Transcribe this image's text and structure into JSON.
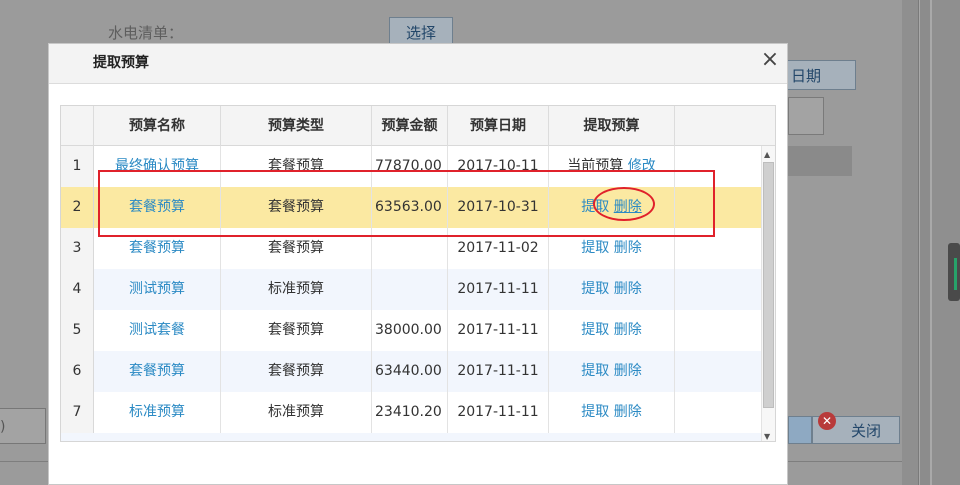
{
  "background": {
    "utility_label": "水电清单：",
    "select_button": "选择",
    "date_button": "日期",
    "close_button": "关闭",
    "left_input_value": ")"
  },
  "dialog": {
    "title": "提取预算",
    "close_symbol": "×"
  },
  "grid": {
    "columns": [
      "预算名称",
      "预算类型",
      "预算金额",
      "预算日期",
      "提取预算"
    ],
    "rows": [
      {
        "index": "1",
        "name": "最终确认预算",
        "type": "套餐预算",
        "amount": "77870.00",
        "date": "2017-10-11",
        "action1": "当前预算",
        "action2": "修改",
        "selected": false
      },
      {
        "index": "2",
        "name": "套餐预算",
        "type": "套餐预算",
        "amount": "63563.00",
        "date": "2017-10-31",
        "action1": "提取",
        "action2": "删除",
        "selected": true
      },
      {
        "index": "3",
        "name": "套餐预算",
        "type": "套餐预算",
        "amount": "",
        "date": "2017-11-02",
        "action1": "提取",
        "action2": "删除",
        "selected": false
      },
      {
        "index": "4",
        "name": "测试预算",
        "type": "标准预算",
        "amount": "",
        "date": "2017-11-11",
        "action1": "提取",
        "action2": "删除",
        "selected": false
      },
      {
        "index": "5",
        "name": "测试套餐",
        "type": "套餐预算",
        "amount": "38000.00",
        "date": "2017-11-11",
        "action1": "提取",
        "action2": "删除",
        "selected": false
      },
      {
        "index": "6",
        "name": "套餐预算",
        "type": "套餐预算",
        "amount": "63440.00",
        "date": "2017-11-11",
        "action1": "提取",
        "action2": "删除",
        "selected": false
      },
      {
        "index": "7",
        "name": "标准预算",
        "type": "标准预算",
        "amount": "23410.20",
        "date": "2017-11-11",
        "action1": "提取",
        "action2": "删除",
        "selected": false
      }
    ]
  },
  "annotation_color": "#e0212b",
  "selected_row_color": "#fbe9a2",
  "link_color": "#2b8ac4"
}
